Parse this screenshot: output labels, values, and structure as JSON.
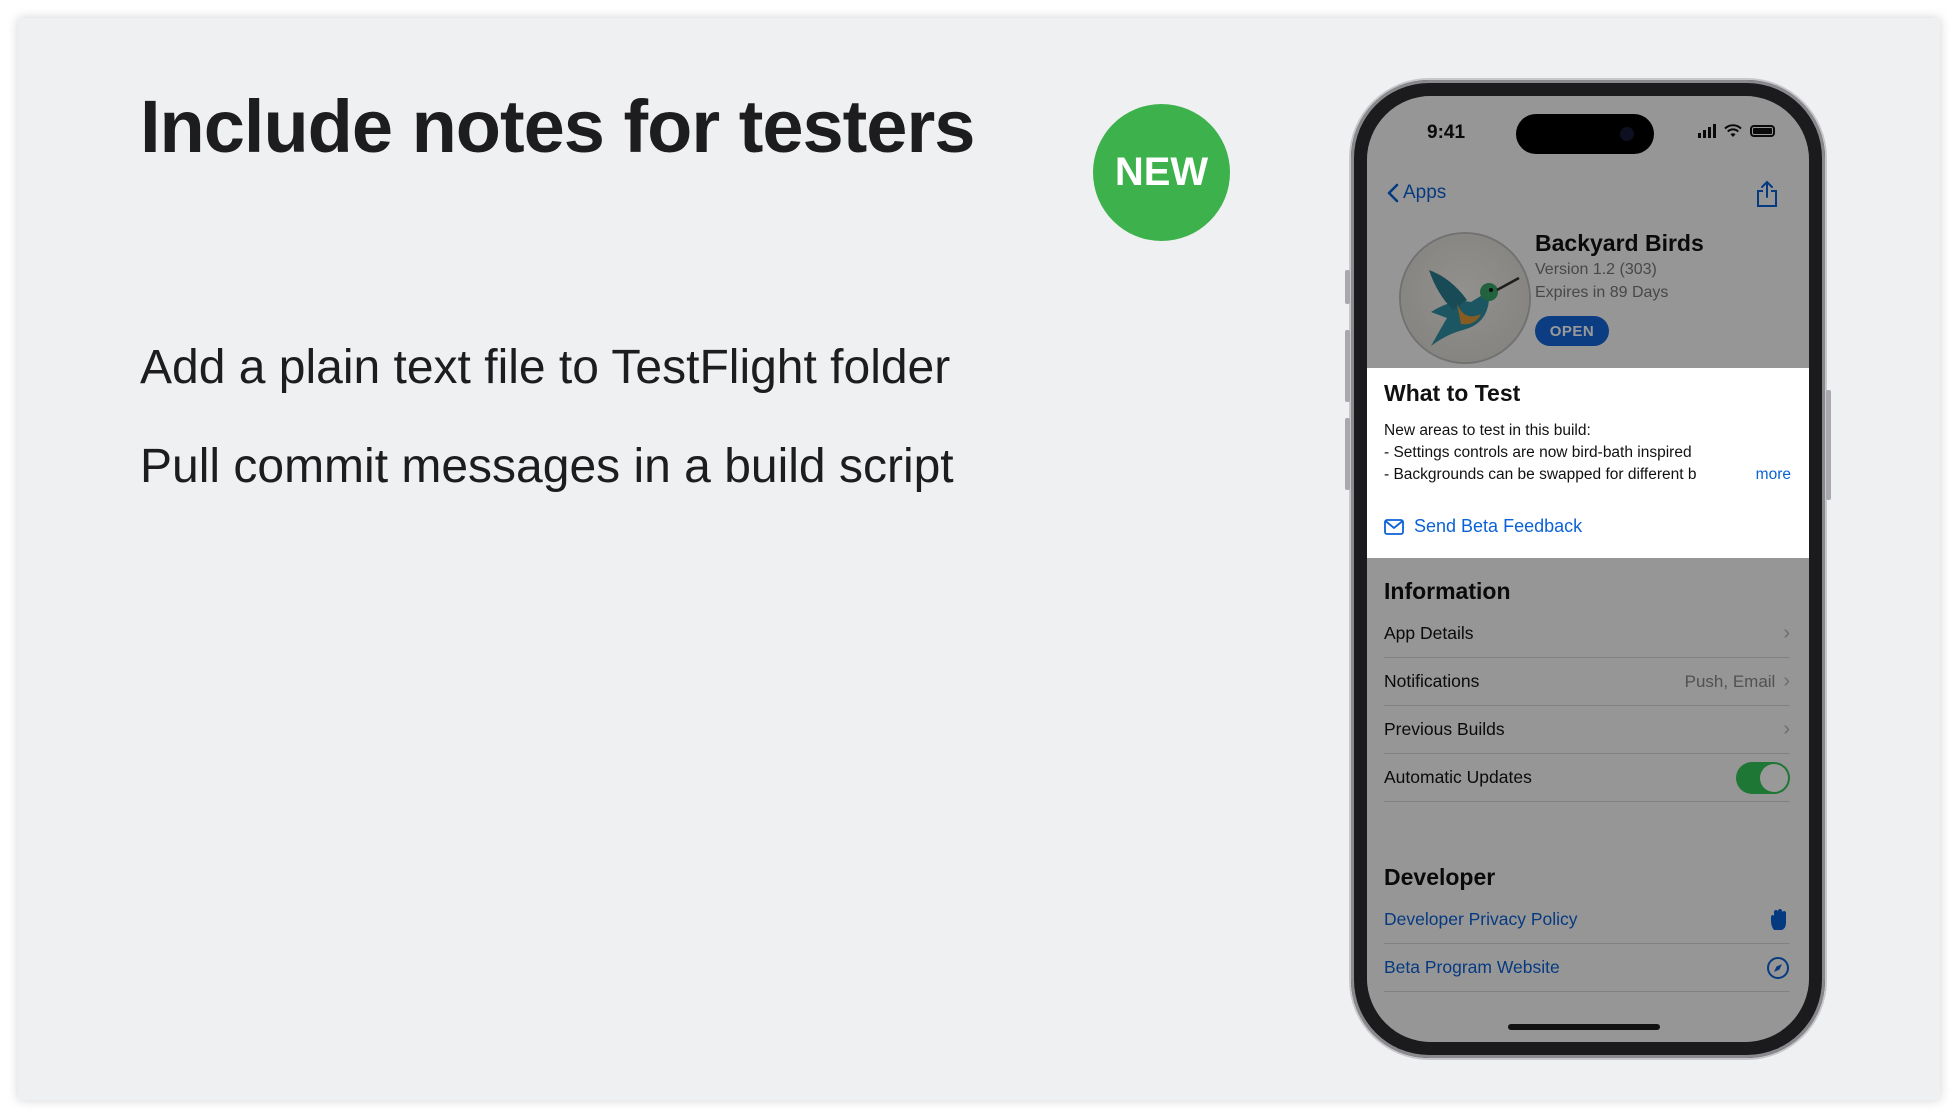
{
  "slide": {
    "title": "Include notes for testers",
    "badge": "NEW",
    "bullets": [
      "Add a plain text file to TestFlight folder",
      "Pull commit messages in a build script"
    ]
  },
  "phone": {
    "status_time": "9:41",
    "nav": {
      "back_label": "Apps"
    },
    "app": {
      "name": "Backyard Birds",
      "version": "Version 1.2 (303)",
      "expires": "Expires in 89 Days",
      "open_label": "OPEN"
    },
    "what_to_test": {
      "title": "What to Test",
      "lines": [
        "New areas to test in this build:",
        "- Settings controls are now bird-bath inspired",
        "- Backgrounds can be swapped for different b"
      ],
      "more_label": "more",
      "feedback_label": "Send Beta Feedback"
    },
    "information": {
      "title": "Information",
      "rows": [
        {
          "label": "App Details",
          "value": ""
        },
        {
          "label": "Notifications",
          "value": "Push, Email"
        },
        {
          "label": "Previous Builds",
          "value": ""
        },
        {
          "label": "Automatic Updates",
          "toggle": true
        }
      ]
    },
    "developer": {
      "title": "Developer",
      "rows": [
        {
          "label": "Developer Privacy Policy",
          "icon": "hand-icon"
        },
        {
          "label": "Beta Program Website",
          "icon": "compass-icon"
        }
      ]
    }
  },
  "colors": {
    "badge_green": "#3db14b",
    "link_blue": "#0a62d6",
    "toggle_green": "#34c759"
  }
}
